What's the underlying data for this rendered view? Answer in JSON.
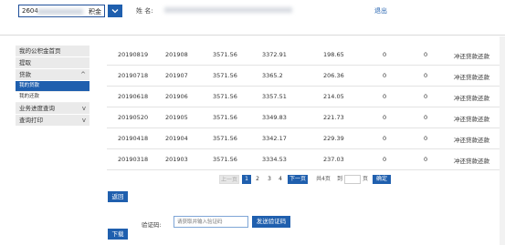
{
  "header": {
    "account_prefix": "2604",
    "account_suffix": "积金",
    "name_label": "姓 名:",
    "logout": "退出"
  },
  "sidebar": {
    "items": [
      {
        "label": "我的公积金首页",
        "chev": ""
      },
      {
        "label": "提取",
        "chev": ""
      },
      {
        "label": "贷款",
        "chev": "^"
      },
      {
        "label": "我的贷款",
        "chev": ""
      },
      {
        "label": "我的还款",
        "chev": ""
      },
      {
        "label": "业务进度查询",
        "chev": "v"
      },
      {
        "label": "查询打印",
        "chev": "v"
      }
    ]
  },
  "table": {
    "rows": [
      [
        "20190819",
        "201908",
        "3571.56",
        "3372.91",
        "198.65",
        "0",
        "0",
        "冲还贷款还款"
      ],
      [
        "20190718",
        "201907",
        "3571.56",
        "3365.2",
        "206.36",
        "0",
        "0",
        "冲还贷款还款"
      ],
      [
        "20190618",
        "201906",
        "3571.56",
        "3357.51",
        "214.05",
        "0",
        "0",
        "冲还贷款还款"
      ],
      [
        "20190520",
        "201905",
        "3571.56",
        "3349.83",
        "221.73",
        "0",
        "0",
        "冲还贷款还款"
      ],
      [
        "20190418",
        "201904",
        "3571.56",
        "3342.17",
        "229.39",
        "0",
        "0",
        "冲还贷款还款"
      ],
      [
        "20190318",
        "201903",
        "3571.56",
        "3334.53",
        "237.03",
        "0",
        "0",
        "冲还贷款还款"
      ]
    ]
  },
  "pager": {
    "prev": "上一页",
    "pages": [
      "1",
      "2",
      "3",
      "4"
    ],
    "current": "1",
    "next": "下一页",
    "total": "共4页",
    "goto": "到",
    "page": "页",
    "confirm": "确定"
  },
  "actions": {
    "back": "返回",
    "verify_label": "验证码:",
    "verify_placeholder": "请获取并输入验证码",
    "send_code": "发送验证码",
    "download": "下载"
  }
}
